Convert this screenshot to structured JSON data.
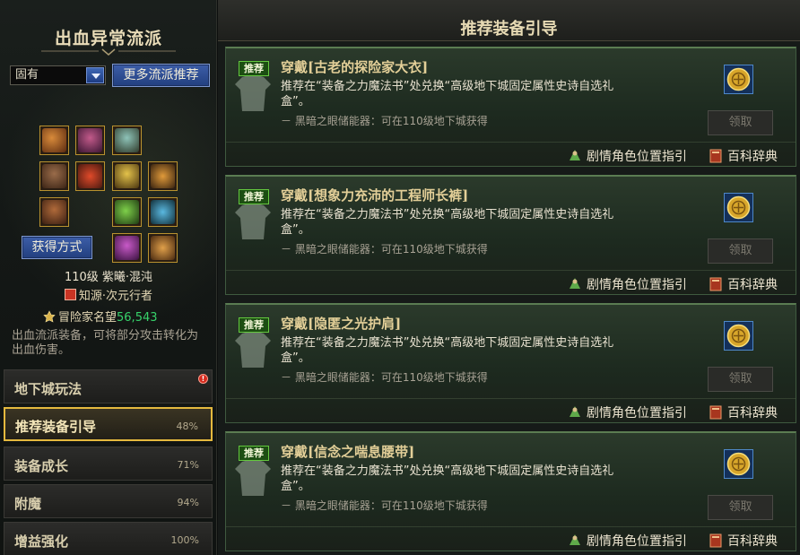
{
  "left": {
    "style_title": "出血异常流派",
    "select_value": "固有",
    "more_button": "更多流派推荐",
    "acquire_button": "获得方式",
    "character": {
      "level_name": "110级 紫曦·混沌",
      "title": "知源·次元行者",
      "fame_label": "冒险家名望",
      "fame_value": "56,543"
    },
    "description": "出血流派装备，可将部分攻击转化为出血伤害。",
    "menu": [
      {
        "label": "地下城玩法",
        "percent": "",
        "alert": "!"
      },
      {
        "label": "推荐装备引导",
        "percent": "48%"
      },
      {
        "label": "装备成长",
        "percent": "71%"
      },
      {
        "label": "附魔",
        "percent": "94%"
      },
      {
        "label": "增益强化",
        "percent": "100%"
      }
    ]
  },
  "right": {
    "header": "推荐装备引导",
    "cards": [
      {
        "tag": "推荐",
        "title": "穿戴[古老的探险家大衣]",
        "desc": "推荐在“装备之力魔法书”处兑换“高级地下城固定属性史诗自选礼盒”。",
        "sub": "－ 黑暗之眼储能器：可在110级地下城获得",
        "claim": "领取",
        "link1": "剧情角色位置指引",
        "link2": "百科辞典"
      },
      {
        "tag": "推荐",
        "title": "穿戴[想象力充沛的工程师长裤]",
        "desc": "推荐在“装备之力魔法书”处兑换“高级地下城固定属性史诗自选礼盒”。",
        "sub": "－ 黑暗之眼储能器：可在110级地下城获得",
        "claim": "领取",
        "link1": "剧情角色位置指引",
        "link2": "百科辞典"
      },
      {
        "tag": "推荐",
        "title": "穿戴[隐匿之光护肩]",
        "desc": "推荐在“装备之力魔法书”处兑换“高级地下城固定属性史诗自选礼盒”。",
        "sub": "－ 黑暗之眼储能器：可在110级地下城获得",
        "claim": "领取",
        "link1": "剧情角色位置指引",
        "link2": "百科辞典"
      },
      {
        "tag": "推荐",
        "title": "穿戴[信念之喘息腰带]",
        "desc": "推荐在“装备之力魔法书”处兑换“高级地下城固定属性史诗自选礼盒”。",
        "sub": "－ 黑暗之眼储能器：可在110级地下城获得",
        "claim": "领取",
        "link1": "剧情角色位置指引",
        "link2": "百科辞典"
      }
    ]
  }
}
